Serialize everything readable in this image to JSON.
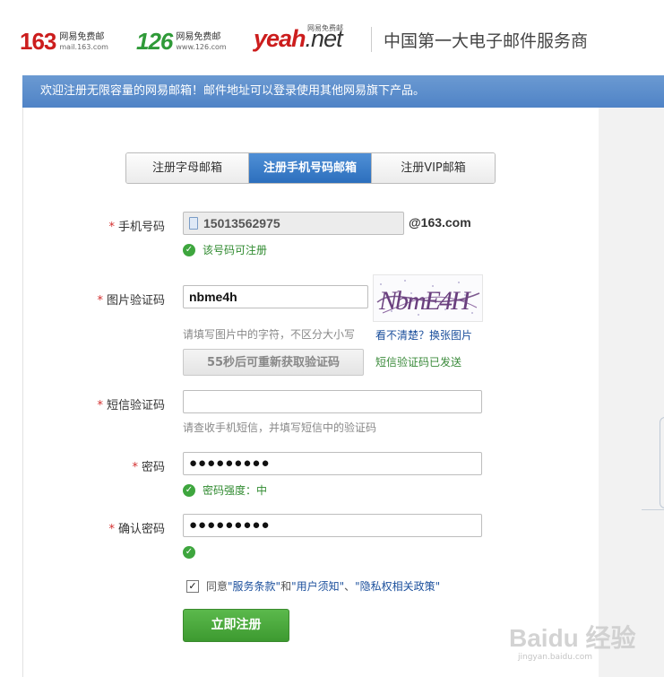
{
  "header": {
    "logo163": {
      "number": "163",
      "cn": "网易免费邮",
      "url": "mail.163.com"
    },
    "logo126": {
      "number": "126",
      "cn": "网易免费邮",
      "url": "www.126.com"
    },
    "yeah": {
      "brand": "yeah",
      "suffix": ".net",
      "cn": "网易免费邮"
    },
    "slogan": "中国第一大电子邮件服务商"
  },
  "banner": "欢迎注册无限容量的网易邮箱！邮件地址可以登录使用其他网易旗下产品。",
  "tabs": [
    {
      "label": "注册字母邮箱",
      "active": false
    },
    {
      "label": "注册手机号码邮箱",
      "active": true
    },
    {
      "label": "注册VIP邮箱",
      "active": false
    }
  ],
  "form": {
    "required_mark": "*",
    "phone": {
      "label": "手机号码",
      "value": "15013562975",
      "suffix": "@163.com",
      "status": "该号码可注册"
    },
    "captcha": {
      "label": "图片验证码",
      "value": "nbme4h",
      "hint": "请填写图片中的字符，不区分大小写",
      "refresh_link": "看不清楚？换张图片",
      "image_text": "NbmE4H"
    },
    "resend_button": "55秒后可重新获取验证码",
    "sms_sent": "短信验证码已发送",
    "sms": {
      "label": "短信验证码",
      "value": "",
      "hint": "请查收手机短信，并填写短信中的验证码"
    },
    "password": {
      "label": "密码",
      "value": "●●●●●●●●●",
      "status": "密码强度：中"
    },
    "confirm": {
      "label": "确认密码",
      "value": "●●●●●●●●●"
    },
    "agree": {
      "checked": "✓",
      "prefix": "同意",
      "terms": "\"服务条款\"",
      "and": "和",
      "notice": "\"用户须知\"",
      "sep": "、",
      "privacy": "\"隐私权相关政策\""
    },
    "submit": "立即注册"
  },
  "watermark": {
    "text": "Baidu 经验",
    "url": "jingyan.baidu.com"
  }
}
